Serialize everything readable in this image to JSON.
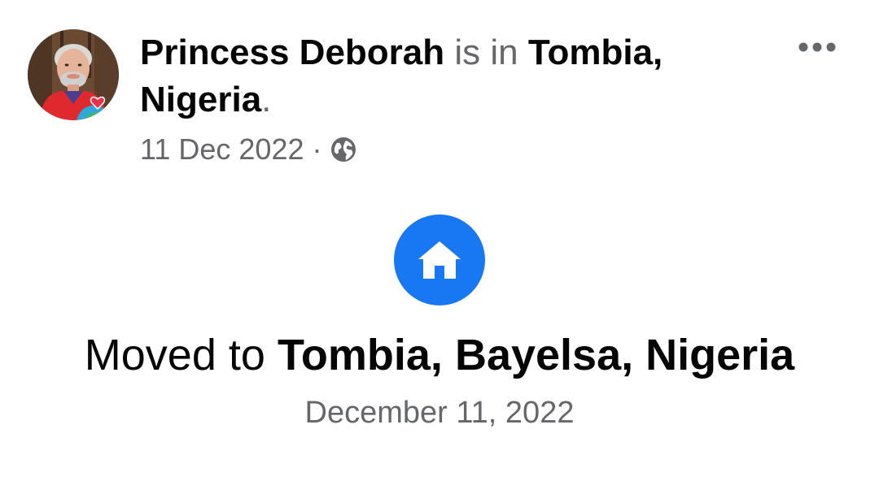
{
  "post": {
    "author_name": "Princess Deborah",
    "connector": "is in",
    "location_line1": "Tombia,",
    "location_line2": "Nigeria",
    "end_punctuation": ".",
    "timestamp": "11 Dec 2022",
    "separator": "·",
    "privacy_icon": "globe-icon",
    "menu_icon": "more-options-icon"
  },
  "life_event": {
    "icon": "home-icon",
    "prefix": "Moved to",
    "place": "Tombia, Bayelsa, Nigeria",
    "date": "December 11, 2022"
  },
  "colors": {
    "primary_text": "#050505",
    "secondary_text": "#65676b",
    "accent_blue": "#1877f2"
  }
}
